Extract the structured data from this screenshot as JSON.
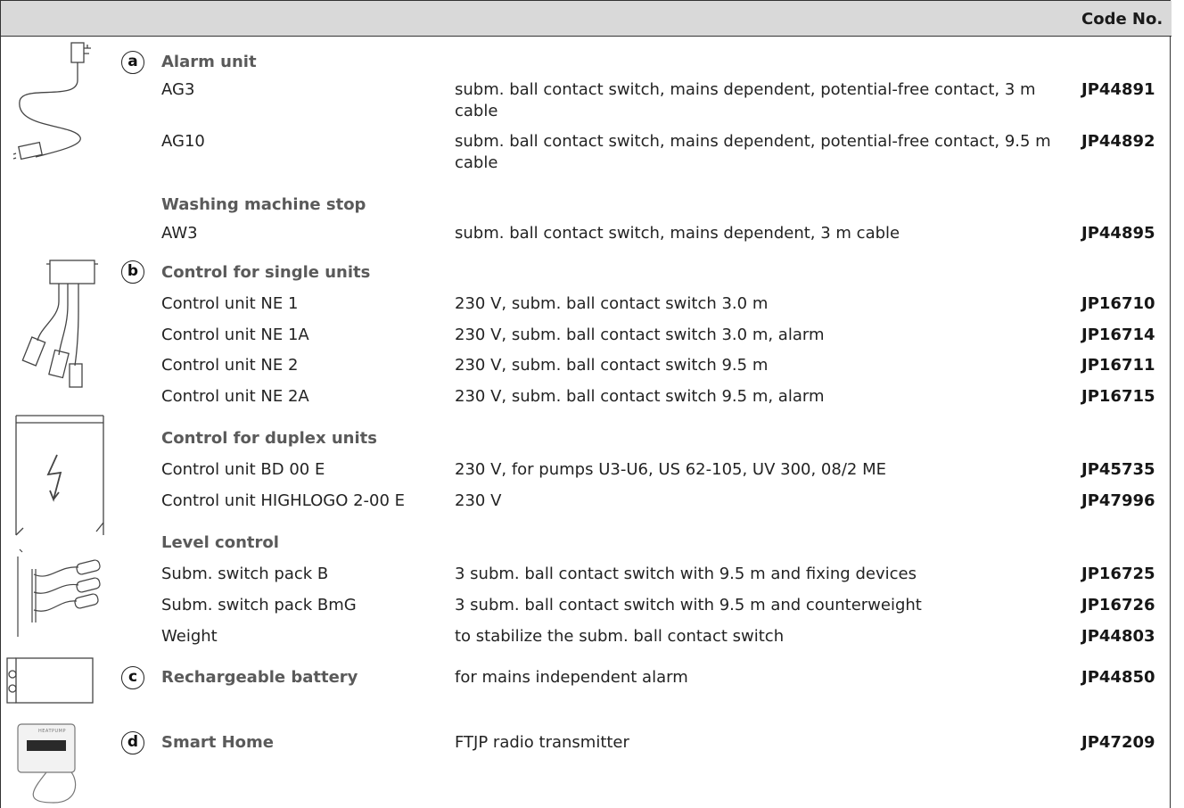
{
  "header": {
    "code_label": "Code No."
  },
  "sections": [
    {
      "badge": "a",
      "title": "Alarm unit",
      "rows": [
        {
          "name": "AG3",
          "desc": "subm. ball contact switch, mains dependent, potential-free contact, 3 m cable",
          "code": "JP44891"
        },
        {
          "name": "AG10",
          "desc": "subm. ball contact switch, mains dependent, potential-free contact, 9.5 m cable",
          "code": "JP44892"
        }
      ]
    },
    {
      "title": "Washing machine stop",
      "rows": [
        {
          "name": "AW3",
          "desc": "subm. ball contact switch, mains dependent, 3 m cable",
          "code": "JP44895"
        }
      ]
    },
    {
      "badge": "b",
      "title": "Control for single units",
      "rows": [
        {
          "name": "Control unit NE 1",
          "desc": "230 V, subm. ball contact switch 3.0 m",
          "code": "JP16710"
        },
        {
          "name": "Control unit NE 1A",
          "desc": "230 V, subm. ball contact switch 3.0 m, alarm",
          "code": "JP16714"
        },
        {
          "name": "Control unit NE 2",
          "desc": "230 V, subm. ball contact switch 9.5 m",
          "code": "JP16711"
        },
        {
          "name": "Control unit NE 2A",
          "desc": "230 V, subm. ball contact switch 9.5 m, alarm",
          "code": "JP16715"
        }
      ]
    },
    {
      "title": "Control for duplex units",
      "rows": [
        {
          "name": "Control unit BD 00 E",
          "desc": "230 V, for pumps U3-U6, US 62-105, UV 300, 08/2 ME",
          "code": "JP45735"
        },
        {
          "name": "Control unit HIGHLOGO 2-00 E",
          "desc": "230 V",
          "code": "JP47996"
        }
      ]
    },
    {
      "title": "Level control",
      "rows": [
        {
          "name": "Subm. switch pack B",
          "desc": "3 subm. ball contact switch with 9.5 m and fixing devices",
          "code": "JP16725"
        },
        {
          "name": "Subm. switch pack BmG",
          "desc": "3 subm. ball contact switch with 9.5 m and counterweight",
          "code": "JP16726"
        },
        {
          "name": "Weight",
          "desc": "to stabilize the subm. ball contact switch",
          "code": "JP44803"
        }
      ]
    },
    {
      "badge": "c",
      "title": "Rechargeable battery",
      "desc": "for mains independent alarm",
      "code": "JP44850"
    },
    {
      "badge": "d",
      "title": "Smart Home",
      "desc": "FTJP radio transmitter",
      "code": "JP47209",
      "device_label": "HEATPUMP"
    }
  ]
}
